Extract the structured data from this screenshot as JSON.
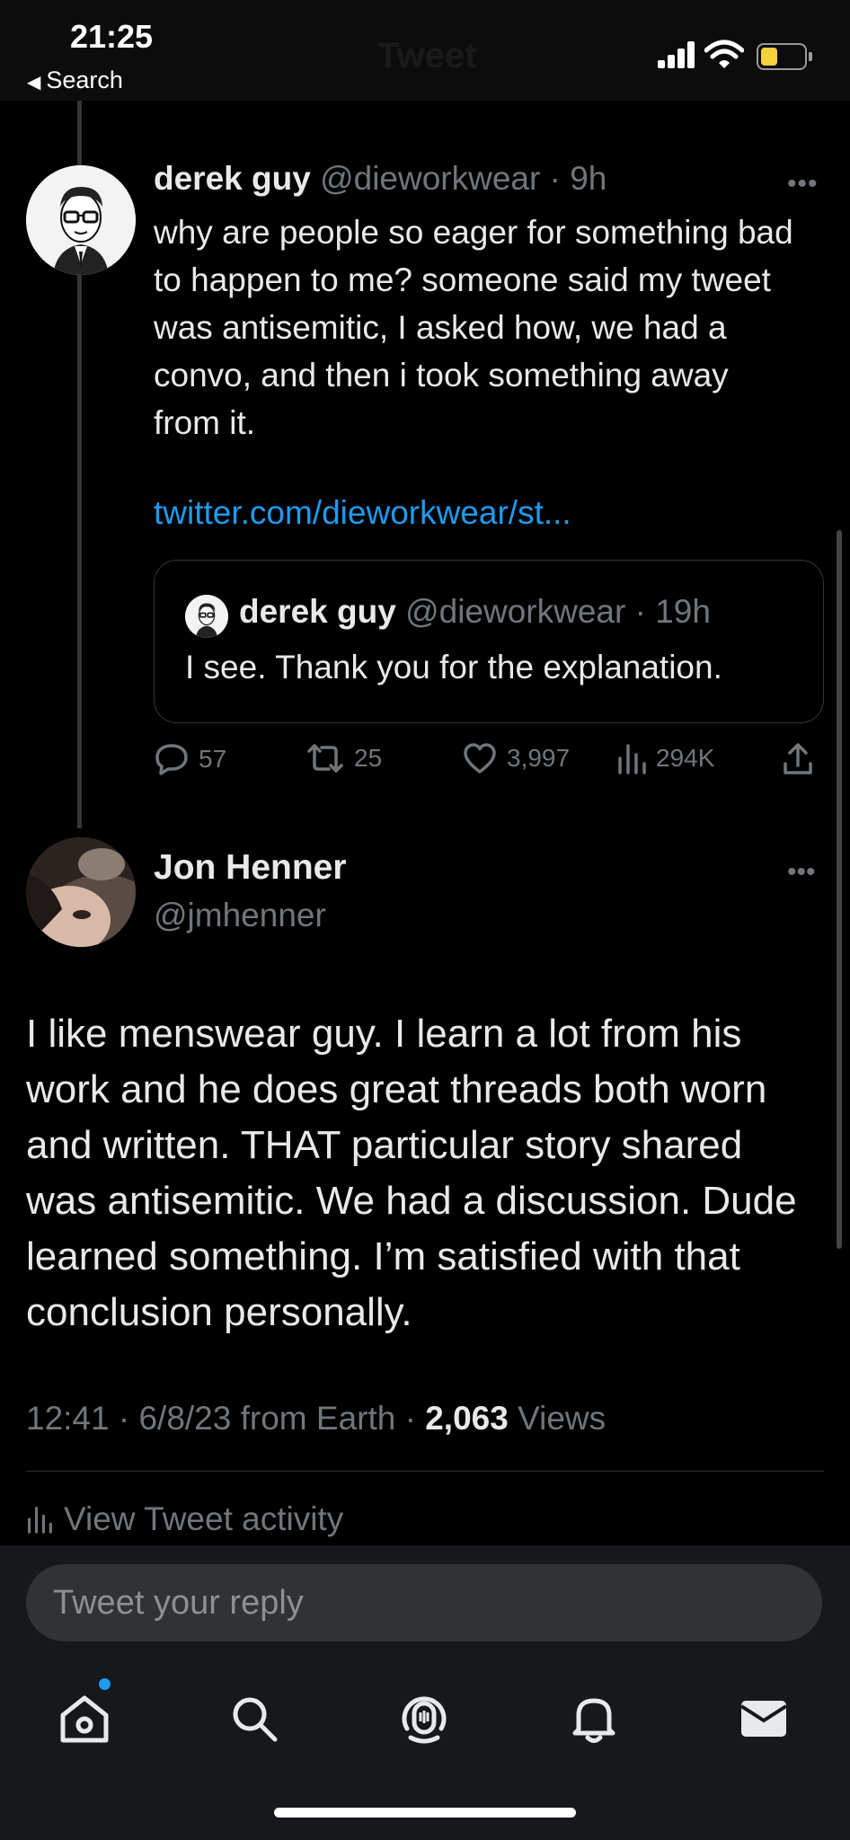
{
  "status_bar": {
    "time": "21:25",
    "back_label": "Search",
    "ghost_title": "Tweet"
  },
  "tweet1": {
    "author_name": "derek guy",
    "author_handle": "@dieworkwear",
    "time": "9h",
    "body": "why are people so eager for something bad to happen to me? someone said my tweet was antisemitic, I asked how, we had a convo, and then i took something away from it.",
    "link": "twitter.com/dieworkwear/st...",
    "quote": {
      "author_name": "derek guy",
      "author_handle": "@dieworkwear",
      "time": "19h",
      "body": "I see. Thank you for the explanation."
    },
    "actions": {
      "replies": "57",
      "retweets": "25",
      "likes": "3,997",
      "views": "294K"
    }
  },
  "tweet2": {
    "author_name": "Jon Henner",
    "author_handle": "@jmhenner",
    "body": "I like menswear guy. I learn a lot from his work and he does great threads both worn and written. THAT particular story shared was antisemitic. We had a discussion. Dude learned something. I’m satisfied with that conclusion personally.",
    "meta_prefix": "12:41 · 6/8/23 from Earth · ",
    "views_count": "2,063",
    "views_label": " Views",
    "view_activity": "View Tweet activity"
  },
  "reply": {
    "placeholder": "Tweet your reply"
  },
  "tab_bar": {
    "icons": [
      "home-icon",
      "search-icon",
      "spaces-icon",
      "notifications-icon",
      "messages-icon"
    ],
    "accent": "#1d9bf0"
  },
  "colors": {
    "link": "#1d9bf0",
    "muted": "#71767b",
    "background": "#000000"
  }
}
